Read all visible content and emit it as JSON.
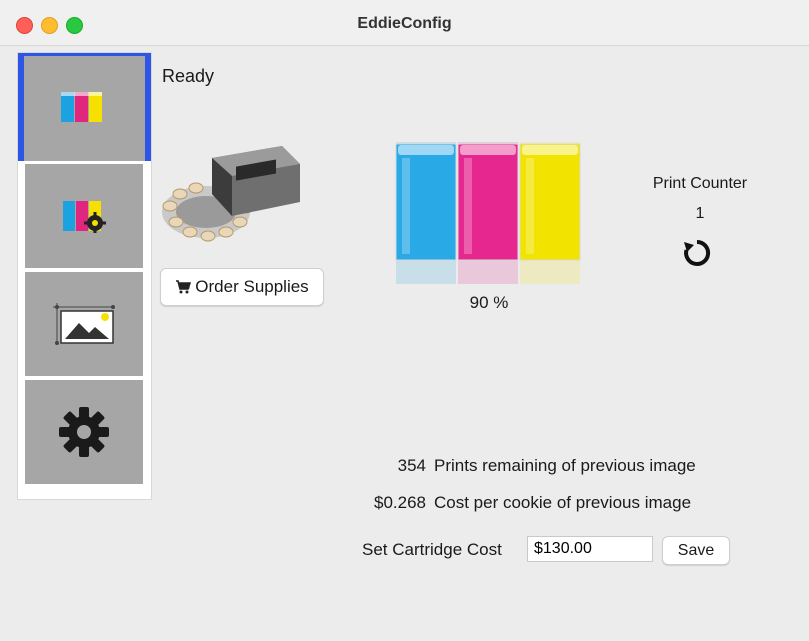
{
  "window": {
    "title": "EddieConfig"
  },
  "sidebar": {
    "items": [
      {
        "icon": "ink-cartridges-icon",
        "selected": true
      },
      {
        "icon": "cartridge-settings-icon",
        "selected": false
      },
      {
        "icon": "image-icon",
        "selected": false
      },
      {
        "icon": "gear-icon",
        "selected": false
      }
    ]
  },
  "status": "Ready",
  "order_supplies": {
    "label": "Order Supplies",
    "icon": "cart-icon"
  },
  "ink": {
    "level_label": "90 %",
    "level_fraction": 0.9,
    "colors": [
      "#29a9e6",
      "#e6278f",
      "#f2e400"
    ]
  },
  "print_counter": {
    "label": "Print Counter",
    "value": "1",
    "reset_icon": "reset-icon"
  },
  "stats": {
    "prints_remaining_value": "354",
    "prints_remaining_label": "Prints remaining of previous image",
    "cost_per_cookie_value": "$0.268",
    "cost_per_cookie_label": "Cost per cookie of previous image"
  },
  "cartridge_cost": {
    "label": "Set Cartridge Cost",
    "value": "$130.00",
    "save_label": "Save"
  }
}
